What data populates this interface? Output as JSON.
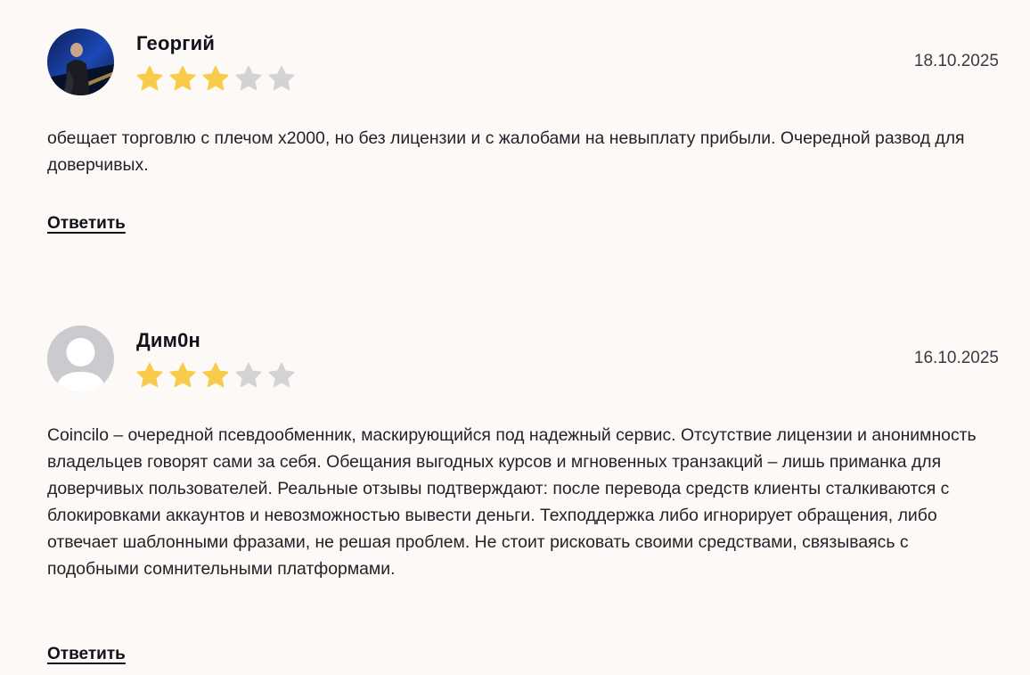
{
  "colors": {
    "background": "#fdf9f6",
    "star_filled": "#f9cb4a",
    "star_empty": "#d3d3d6",
    "text": "#22222a"
  },
  "reviews": [
    {
      "author": "Георгий",
      "avatar": "photo",
      "rating": 3,
      "rating_max": 5,
      "date": "18.10.2025",
      "text": "обещает торговлю с плечом x2000, но без лицензии и с жалобами на невыплату прибыли. Очередной развод для доверчивых.",
      "reply_label": "Ответить"
    },
    {
      "author": "Дим0н",
      "avatar": "default-user-icon",
      "rating": 3,
      "rating_max": 5,
      "date": "16.10.2025",
      "text": "Coincilo – очередной псевдообменник, маскирующийся под надежный сервис. Отсутствие лицензии и анонимность владельцев говорят сами за себя. Обещания выгодных курсов и мгновенных транзакций – лишь приманка для доверчивых пользователей. Реальные отзывы подтверждают: после перевода средств клиенты сталкиваются с блокировками аккаунтов и невозможностью вывести деньги. Техподдержка либо игнорирует обращения, либо отвечает шаблонными фразами, не решая проблем. Не стоит рисковать своими средствами, связываясь с подобными сомнительными платформами.",
      "reply_label": "Ответить"
    }
  ]
}
